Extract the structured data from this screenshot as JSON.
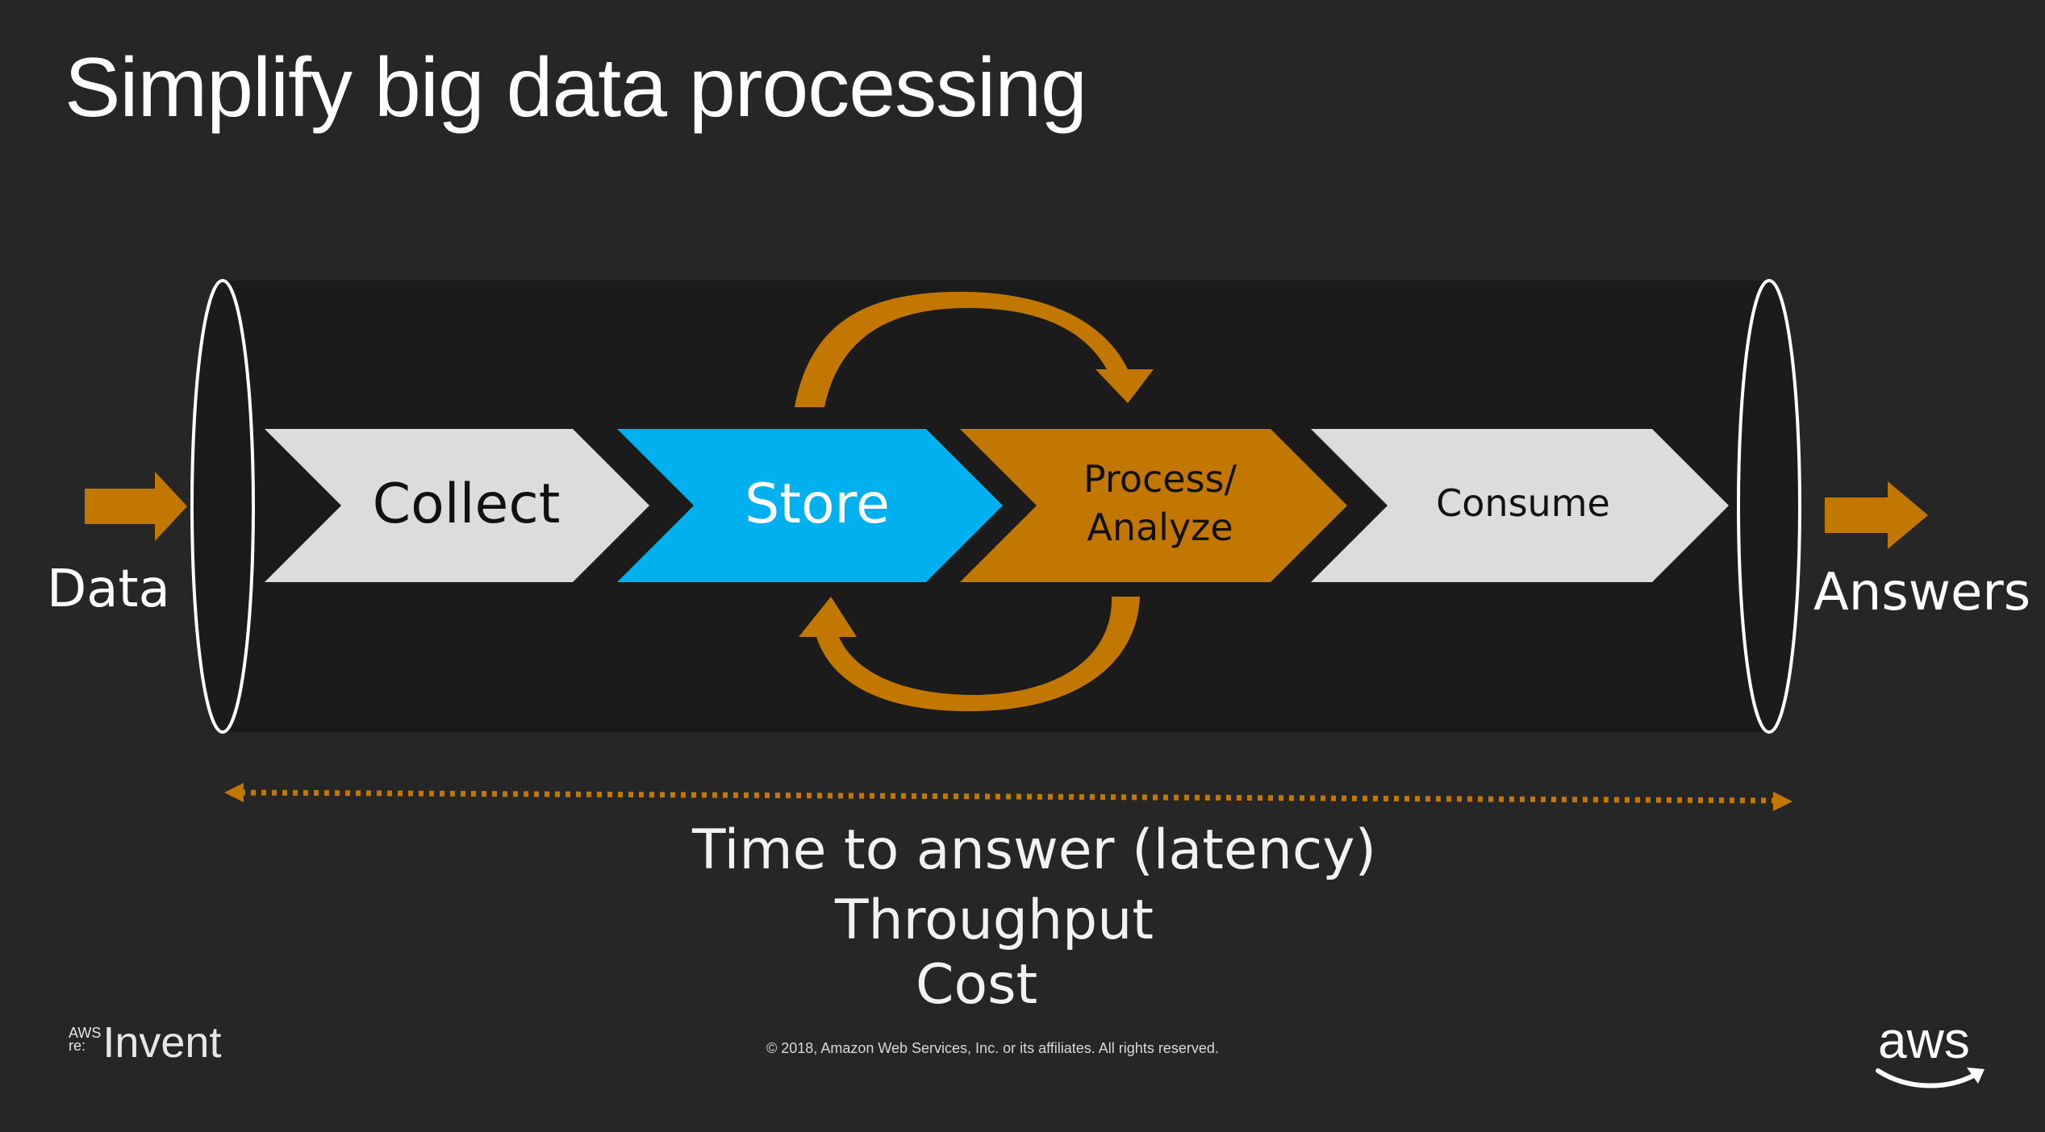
{
  "title": "Simplify big data processing",
  "stages": [
    {
      "label": "Collect",
      "color": "#dcdcdc",
      "text_color": "#111111"
    },
    {
      "label": "Store",
      "color": "#00b0ef",
      "text_color": "#ffffff"
    },
    {
      "label": "Process/",
      "label2": "Analyze",
      "color": "#c27800",
      "text_color": "#111111"
    },
    {
      "label": "Consume",
      "color": "#dcdcdc",
      "text_color": "#111111"
    }
  ],
  "input_label": "Data",
  "output_label": "Answers",
  "metrics": [
    "Time to answer (latency)",
    "Throughput",
    "Cost"
  ],
  "footer": {
    "copyright": "© 2018, Amazon Web Services, Inc. or its affiliates. All rights reserved.",
    "event_logo_prefix_top": "AWS",
    "event_logo_prefix_bottom": "re:",
    "event_logo_word": "Invent",
    "brand_logo_text": "aws"
  },
  "colors": {
    "background": "#262626",
    "pipe": "#1b1b1b",
    "accent_orange": "#c27800",
    "store_blue": "#00b0ef",
    "neutral_chevron": "#dcdcdc"
  }
}
